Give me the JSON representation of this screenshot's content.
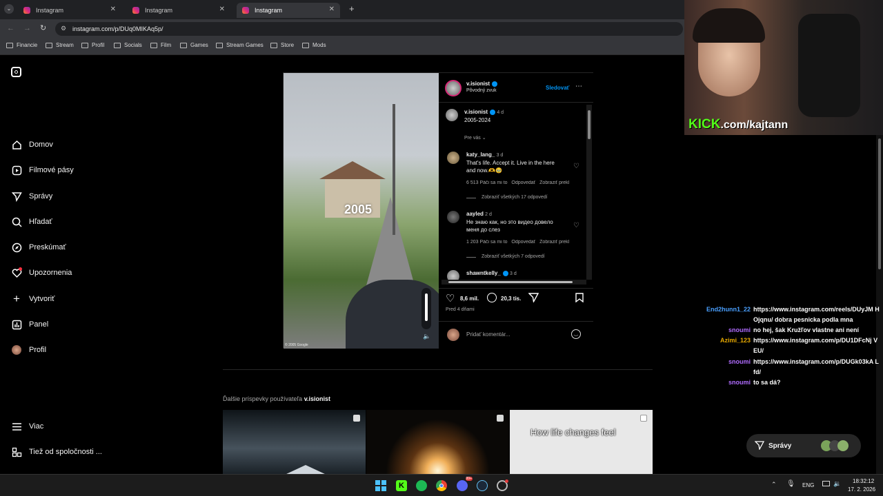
{
  "browser": {
    "tabs": [
      {
        "label": "Instagram"
      },
      {
        "label": "Instagram"
      },
      {
        "label": "Instagram"
      }
    ],
    "url": "instagram.com/p/DUq0MIKAq5p/",
    "bookmarks": [
      "Financie",
      "Stream",
      "Profil",
      "Socials",
      "Film",
      "Games",
      "Stream Games",
      "Store",
      "Mods"
    ]
  },
  "sidebar": {
    "items": [
      {
        "label": "Domov",
        "icon": "home-icon"
      },
      {
        "label": "Filmové pásy",
        "icon": "reels-icon"
      },
      {
        "label": "Správy",
        "icon": "messages-icon"
      },
      {
        "label": "Hľadať",
        "icon": "search-icon"
      },
      {
        "label": "Preskúmať",
        "icon": "explore-icon"
      },
      {
        "label": "Upozornenia",
        "icon": "heart-icon"
      },
      {
        "label": "Vytvoriť",
        "icon": "plus-icon"
      },
      {
        "label": "Panel",
        "icon": "panel-icon"
      },
      {
        "label": "Profil",
        "icon": "avatar"
      }
    ],
    "more": "Viac",
    "also": "Tiež od spoločnosti ..."
  },
  "post": {
    "overlay_year": "2005",
    "copyright": "© 2005 Google",
    "author": "v.isionist",
    "audio": "Pôvodný zvuk",
    "follow": "Sledovať",
    "caption_time": "4 d",
    "caption": "2005-2024",
    "for_you": "Pre vás",
    "comments": [
      {
        "user": "katy_lang_",
        "time": "3 d",
        "text1": "That's life. Accept it. Live in the here",
        "text2": "and now.🫶🥹",
        "likes": "6 513 Páči sa mi to",
        "reply": "Odpovedať",
        "translate": "Zobraziť prekl",
        "view_replies": "Zobraziť všetkých 17 odpovedí"
      },
      {
        "user": "aayled",
        "time": "2 d",
        "text1": "Не знаю как, но это видео довело",
        "text2": "меня до слез",
        "likes": "1 203 Páči sa mi to",
        "reply": "Odpovedať",
        "translate": "Zobraziť prekl",
        "view_replies": "Zobraziť všetkých 7 odpovedí"
      },
      {
        "user": "shawntkelly_",
        "time": "3 d"
      }
    ],
    "like_count": "8,6 mil.",
    "comment_count": "20,3 tis.",
    "posted": "Pred 4 dňami",
    "add_comment": "Pridať komentár..."
  },
  "more_posts": {
    "label_prefix": "Ďalšie príspevky používateľa",
    "label_user": "v.isionist",
    "thumb3_text": "How life changes feel"
  },
  "stream": {
    "kick_brand": "KICK",
    "kick_url": ".com/kajtann",
    "chat": [
      {
        "name": "End2hunn1_22",
        "color": "#4aa0ff",
        "text": "https://www.instagram.com/reels/DUyJM HOjqnu/ dobra pesnicka podla mna"
      },
      {
        "name": "snoumi",
        "color": "#b06cff",
        "text": "no hej, šak Kružľov vlastne ani není"
      },
      {
        "name": "Azimi_123",
        "color": "#e6a800",
        "text": "https://www.instagram.com/p/DU1DFcNj VEU/"
      },
      {
        "name": "snoumi",
        "color": "#b06cff",
        "text": "https://www.instagram.com/p/DUGk03kA Lfd/"
      },
      {
        "name": "snoumi",
        "color": "#b06cff",
        "text": "to sa dá?"
      }
    ]
  },
  "messages_pill": "Správy",
  "taskbar": {
    "lang": "ENG",
    "time": "18:32:12",
    "date": "17. 2. 2026",
    "badge": "99+"
  }
}
